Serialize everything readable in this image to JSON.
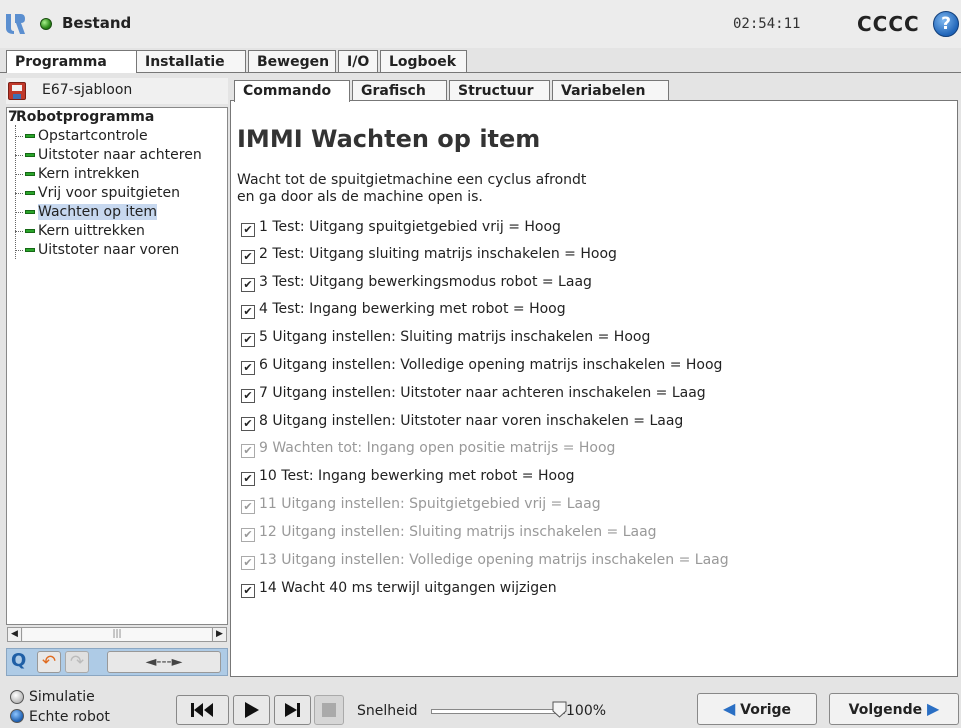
{
  "header": {
    "file_menu": "Bestand",
    "clock": "02:54:11",
    "robot_name": "CCCC",
    "help_label": "?",
    "logo_icon": "ur-logo-icon",
    "status_color": "#2d8a1a"
  },
  "main_tabs": [
    {
      "label": "Programma",
      "active": true
    },
    {
      "label": "Installatie",
      "active": false
    },
    {
      "label": "Bewegen",
      "active": false
    },
    {
      "label": "I/O",
      "active": false
    },
    {
      "label": "Logboek",
      "active": false
    }
  ],
  "program": {
    "name": "E67-sjabloon",
    "icon": "floppy-disk-icon"
  },
  "tree": {
    "root_prefix": "7",
    "root_label": "Robotprogramma",
    "items": [
      {
        "label": "Opstartcontrole",
        "selected": false
      },
      {
        "label": "Uitstoter naar achteren",
        "selected": false
      },
      {
        "label": "Kern intrekken",
        "selected": false
      },
      {
        "label": "Vrij voor spuitgieten",
        "selected": false
      },
      {
        "label": "Wachten op item",
        "selected": true
      },
      {
        "label": "Kern uittrekken",
        "selected": false
      },
      {
        "label": "Uitstoter naar voren",
        "selected": false
      }
    ]
  },
  "toolbar": {
    "search_label": "Q",
    "move_label": "◄---►",
    "undo_icon": "undo-icon",
    "redo_icon": "redo-icon"
  },
  "sub_tabs": [
    {
      "label": "Commando",
      "active": true
    },
    {
      "label": "Grafisch",
      "active": false
    },
    {
      "label": "Structuur",
      "active": false
    },
    {
      "label": "Variabelen",
      "active": false
    }
  ],
  "content": {
    "title": "IMMI Wachten op item",
    "description_line1": "Wacht tot de spuitgietmachine een cyclus afrondt",
    "description_line2": "en ga door als de machine open is.",
    "commands": [
      {
        "text": "1 Test: Uitgang spuitgietgebied vrij = Hoog",
        "checked": true,
        "disabled": false
      },
      {
        "text": "2 Test: Uitgang sluiting matrijs inschakelen = Hoog",
        "checked": true,
        "disabled": false
      },
      {
        "text": "3 Test: Uitgang bewerkingsmodus robot = Laag",
        "checked": true,
        "disabled": false
      },
      {
        "text": "4 Test: Ingang bewerking met robot = Hoog",
        "checked": true,
        "disabled": false
      },
      {
        "text": "5 Uitgang instellen: Sluiting matrijs inschakelen = Hoog",
        "checked": true,
        "disabled": false
      },
      {
        "text": "6 Uitgang instellen: Volledige opening matrijs inschakelen = Hoog",
        "checked": true,
        "disabled": false
      },
      {
        "text": "7 Uitgang instellen: Uitstoter naar achteren inschakelen = Laag",
        "checked": true,
        "disabled": false
      },
      {
        "text": "8 Uitgang instellen: Uitstoter naar voren inschakelen = Laag",
        "checked": true,
        "disabled": false
      },
      {
        "text": "9 Wachten tot: Ingang open positie matrijs = Hoog",
        "checked": true,
        "disabled": true
      },
      {
        "text": "10 Test: Ingang bewerking met robot = Hoog",
        "checked": true,
        "disabled": false
      },
      {
        "text": "11 Uitgang instellen: Spuitgietgebied vrij = Laag",
        "checked": true,
        "disabled": true
      },
      {
        "text": "12 Uitgang instellen: Sluiting matrijs inschakelen = Laag",
        "checked": true,
        "disabled": true
      },
      {
        "text": "13 Uitgang instellen: Volledige opening matrijs inschakelen = Laag",
        "checked": true,
        "disabled": true
      },
      {
        "text": "14 Wacht 40 ms terwijl uitgangen wijzigen",
        "checked": true,
        "disabled": false
      }
    ]
  },
  "footer": {
    "simulation_label": "Simulatie",
    "real_robot_label": "Echte robot",
    "speed_label": "Snelheid",
    "speed_value": "100%",
    "speed_fraction": 1.0,
    "prev_label": "Vorige",
    "next_label": "Volgende",
    "accent_color": "#2a6fc4"
  }
}
